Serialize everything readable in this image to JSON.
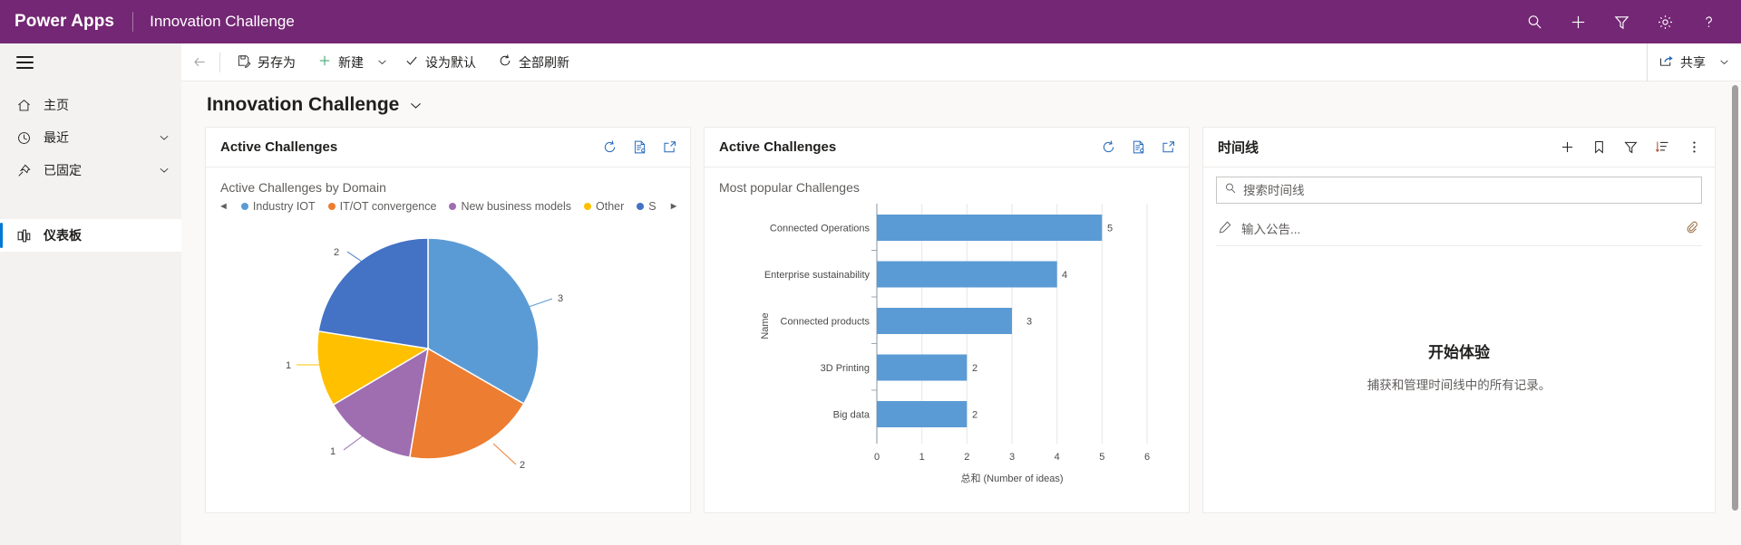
{
  "topbar": {
    "brand": "Power Apps",
    "app_name": "Innovation Challenge",
    "icons": [
      {
        "name": "search-icon",
        "label": "搜索"
      },
      {
        "name": "plus-icon",
        "label": "新建"
      },
      {
        "name": "filter-icon",
        "label": "筛选"
      },
      {
        "name": "gear-icon",
        "label": "设置"
      },
      {
        "name": "help-icon",
        "label": "帮助"
      }
    ]
  },
  "commandbar": {
    "back_label": "返回",
    "save_as": "另存为",
    "new": "新建",
    "set_default": "设为默认",
    "refresh_all": "全部刷新",
    "share": "共享"
  },
  "sidebar": {
    "items": [
      {
        "label": "主页",
        "icon": "home-icon",
        "chevron": false,
        "selected": false
      },
      {
        "label": "最近",
        "icon": "clock-icon",
        "chevron": true,
        "selected": false
      },
      {
        "label": "已固定",
        "icon": "pin-icon",
        "chevron": true,
        "selected": false
      }
    ],
    "group_items": [
      {
        "label": "仪表板",
        "icon": "dashboard-icon",
        "selected": true
      }
    ]
  },
  "page": {
    "title": "Innovation Challenge"
  },
  "cards": {
    "pie_card": {
      "title": "Active Challenges",
      "actions": [
        "refresh-icon",
        "records-icon",
        "popout-icon"
      ]
    },
    "bar_card": {
      "title": "Active Challenges",
      "actions": [
        "refresh-icon",
        "records-icon",
        "popout-icon"
      ]
    },
    "timeline_card": {
      "title": "时间线",
      "actions": [
        "plus-icon",
        "bookmark-icon",
        "filter-icon",
        "sort-icon",
        "more-icon"
      ],
      "search_placeholder": "搜索时间线",
      "note_placeholder": "输入公告...",
      "empty_title": "开始体验",
      "empty_sub": "捕获和管理时间线中的所有记录。"
    }
  },
  "chart_data": [
    {
      "type": "pie",
      "title": "Active Challenges by Domain",
      "legend_position": "top",
      "legend_scroll_left": "◄",
      "legend_scroll_right": "►",
      "categories": [
        "Industry IOT",
        "IT/OT convergence",
        "New business models",
        "Other",
        "S"
      ],
      "values": [
        3,
        2,
        1,
        1,
        2
      ],
      "colors": [
        "#5b9bd5",
        "#ed7d31",
        "#9e6eb0",
        "#ffc000",
        "#4472c4"
      ],
      "labels": [
        "3",
        "2",
        "1",
        "1",
        "2"
      ]
    },
    {
      "type": "bar",
      "orientation": "horizontal",
      "title": "Most popular Challenges",
      "categories": [
        "Connected Operations",
        "Enterprise sustainability",
        "Connected products",
        "3D Printing",
        "Big data"
      ],
      "values": [
        5,
        4,
        3,
        2,
        2
      ],
      "value_labels": [
        "5",
        "4",
        "3",
        "2",
        "2"
      ],
      "xlabel": "总和 (Number of ideas)",
      "ylabel": "Name",
      "xlim": [
        0,
        6
      ],
      "xticks": [
        "0",
        "1",
        "2",
        "3",
        "4",
        "5",
        "6"
      ],
      "grid": true,
      "bar_color": "#5b9bd5"
    }
  ],
  "colors": {
    "brand_purple": "#742774",
    "accent_blue": "#0078d4",
    "surface": "#faf9f8",
    "sidebar": "#f3f2f1"
  }
}
